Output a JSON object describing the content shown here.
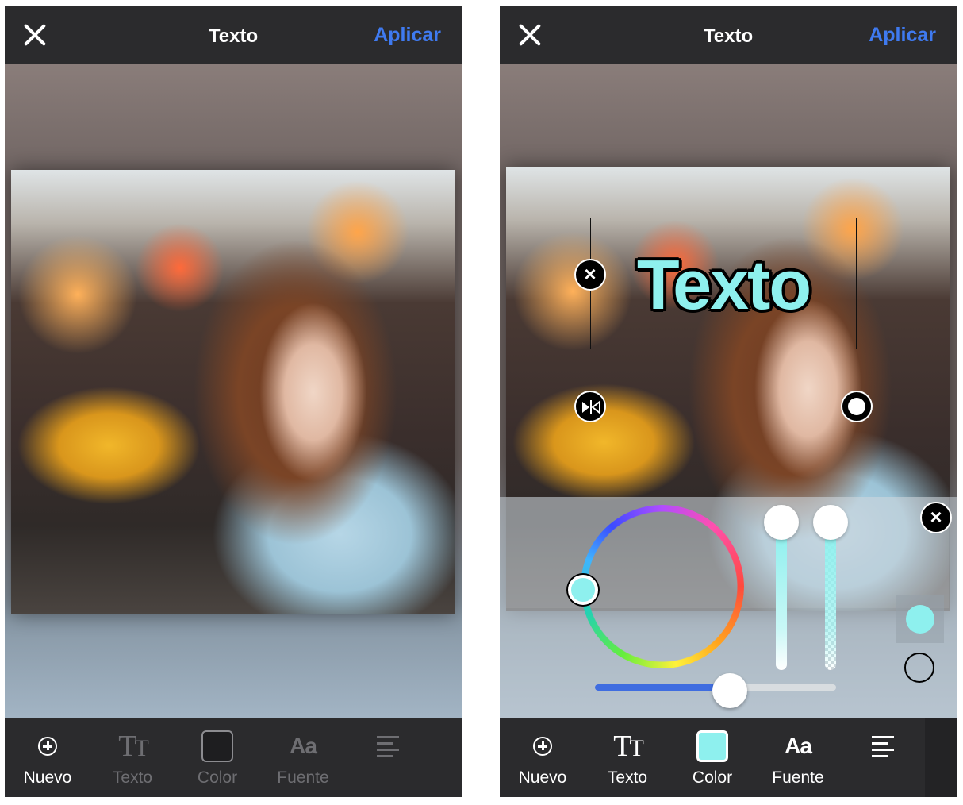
{
  "left": {
    "topbar": {
      "title": "Texto",
      "apply": "Aplicar"
    },
    "toolbar": [
      {
        "label": "Nuevo",
        "icon": "add-circle-icon",
        "enabled": true
      },
      {
        "label": "Texto",
        "icon": "text-size-icon",
        "enabled": false
      },
      {
        "label": "Color",
        "icon": "color-swatch-icon",
        "enabled": false
      },
      {
        "label": "Fuente",
        "icon": "font-icon",
        "enabled": false
      },
      {
        "label": "",
        "icon": "align-left-icon",
        "enabled": false
      }
    ]
  },
  "right": {
    "topbar": {
      "title": "Texto",
      "apply": "Aplicar"
    },
    "text_sample": "Texto",
    "text_color": "#8ef0ee",
    "toolbar": [
      {
        "label": "Nuevo",
        "icon": "add-circle-icon",
        "enabled": true
      },
      {
        "label": "Texto",
        "icon": "text-size-icon",
        "enabled": true
      },
      {
        "label": "Color",
        "icon": "color-swatch-icon",
        "enabled": true,
        "selected": true
      },
      {
        "label": "Fuente",
        "icon": "font-icon",
        "enabled": true
      },
      {
        "label": "",
        "icon": "align-left-icon",
        "enabled": true
      }
    ]
  },
  "colors": {
    "accent": "#3f7af0",
    "bar": "#2b2b2d",
    "selected_color": "#8ef0ee"
  }
}
